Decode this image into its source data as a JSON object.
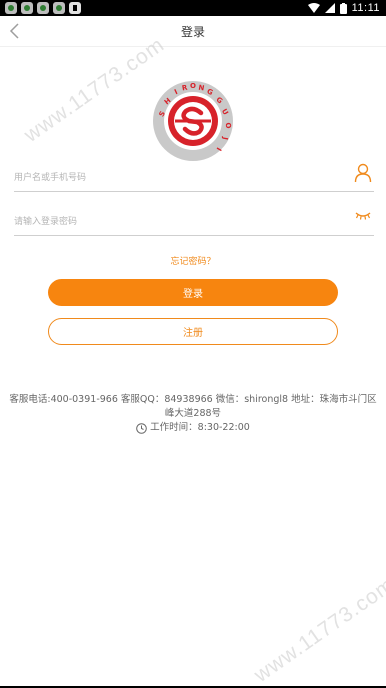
{
  "status_bar": {
    "time": "11:11",
    "notification_icons": [
      "notification-icon",
      "notification-icon",
      "notification-icon",
      "notification-icon",
      "notification-a-icon"
    ]
  },
  "nav": {
    "title": "登录"
  },
  "logo": {
    "text": "SHIRONG GUOJI"
  },
  "login_form": {
    "username_placeholder": "用户名或手机号码",
    "password_placeholder": "请输入登录密码",
    "forgot_label": "忘记密码？",
    "login_label": "登录",
    "register_label": "注册"
  },
  "contact": {
    "line1": "客服电话:400-0391-966    客服QQ：84938966 微信：shirongl8 地址：珠海市斗门区",
    "line2": "峰大道288号",
    "hours": "工作时间：8:30-22:00"
  },
  "watermark": {
    "text": "www.11773.com"
  },
  "colors": {
    "accent": "#f7850f",
    "accent_text": "#f08a1c",
    "logo_red": "#d7222a",
    "logo_ring": "#c9c9c9"
  }
}
